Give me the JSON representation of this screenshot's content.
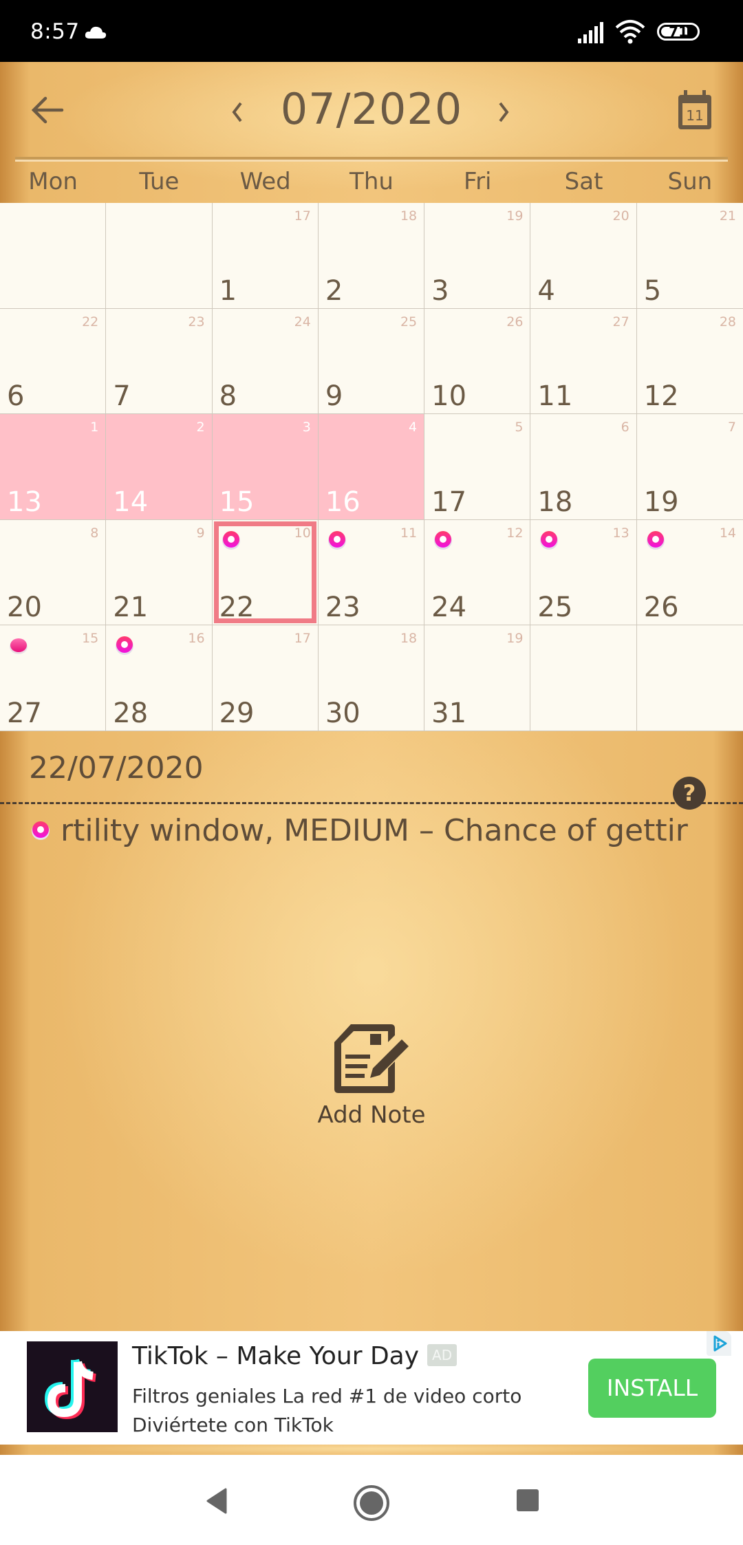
{
  "status_bar": {
    "time": "8:57",
    "battery": "71",
    "icons": [
      "cloud-icon",
      "signal-icon",
      "wifi-icon",
      "battery-icon"
    ]
  },
  "header": {
    "back_icon": "arrow-left-icon",
    "prev_icon": "chevron-left-icon",
    "title": "07/2020",
    "next_icon": "chevron-right-icon",
    "today_icon": "calendar-icon",
    "today_day": "11",
    "weekdays": [
      "Mon",
      "Tue",
      "Wed",
      "Thu",
      "Fri",
      "Sat",
      "Sun"
    ]
  },
  "calendar": {
    "month": "07/2020",
    "selected_day": "22",
    "colors": {
      "period": "#ffc0c8",
      "selected_border": "#f07b86",
      "fertile_marker": "#ff2fa0"
    },
    "cells": [
      {
        "day": "",
        "cycle": "",
        "state": "empty",
        "marker": ""
      },
      {
        "day": "",
        "cycle": "",
        "state": "empty",
        "marker": ""
      },
      {
        "day": "1",
        "cycle": "17",
        "state": "normal",
        "marker": ""
      },
      {
        "day": "2",
        "cycle": "18",
        "state": "normal",
        "marker": ""
      },
      {
        "day": "3",
        "cycle": "19",
        "state": "normal",
        "marker": ""
      },
      {
        "day": "4",
        "cycle": "20",
        "state": "normal",
        "marker": ""
      },
      {
        "day": "5",
        "cycle": "21",
        "state": "normal",
        "marker": ""
      },
      {
        "day": "6",
        "cycle": "22",
        "state": "normal",
        "marker": ""
      },
      {
        "day": "7",
        "cycle": "23",
        "state": "normal",
        "marker": ""
      },
      {
        "day": "8",
        "cycle": "24",
        "state": "normal",
        "marker": ""
      },
      {
        "day": "9",
        "cycle": "25",
        "state": "normal",
        "marker": ""
      },
      {
        "day": "10",
        "cycle": "26",
        "state": "normal",
        "marker": ""
      },
      {
        "day": "11",
        "cycle": "27",
        "state": "normal",
        "marker": ""
      },
      {
        "day": "12",
        "cycle": "28",
        "state": "normal",
        "marker": ""
      },
      {
        "day": "13",
        "cycle": "1",
        "state": "period",
        "marker": ""
      },
      {
        "day": "14",
        "cycle": "2",
        "state": "period",
        "marker": ""
      },
      {
        "day": "15",
        "cycle": "3",
        "state": "period",
        "marker": ""
      },
      {
        "day": "16",
        "cycle": "4",
        "state": "period",
        "marker": ""
      },
      {
        "day": "17",
        "cycle": "5",
        "state": "normal",
        "marker": ""
      },
      {
        "day": "18",
        "cycle": "6",
        "state": "normal",
        "marker": ""
      },
      {
        "day": "19",
        "cycle": "7",
        "state": "normal",
        "marker": ""
      },
      {
        "day": "20",
        "cycle": "8",
        "state": "normal",
        "marker": ""
      },
      {
        "day": "21",
        "cycle": "9",
        "state": "normal",
        "marker": ""
      },
      {
        "day": "22",
        "cycle": "10",
        "state": "selected",
        "marker": "fertile-flower"
      },
      {
        "day": "23",
        "cycle": "11",
        "state": "normal",
        "marker": "fertile-flower"
      },
      {
        "day": "24",
        "cycle": "12",
        "state": "normal",
        "marker": "fertile-flower"
      },
      {
        "day": "25",
        "cycle": "13",
        "state": "normal",
        "marker": "fertile-flower"
      },
      {
        "day": "26",
        "cycle": "14",
        "state": "normal",
        "marker": "fertile-flower"
      },
      {
        "day": "27",
        "cycle": "15",
        "state": "normal",
        "marker": "ovulation-egg"
      },
      {
        "day": "28",
        "cycle": "16",
        "state": "normal",
        "marker": "fertile-flower"
      },
      {
        "day": "29",
        "cycle": "17",
        "state": "normal",
        "marker": ""
      },
      {
        "day": "30",
        "cycle": "18",
        "state": "normal",
        "marker": ""
      },
      {
        "day": "31",
        "cycle": "19",
        "state": "normal",
        "marker": ""
      },
      {
        "day": "",
        "cycle": "",
        "state": "empty",
        "marker": ""
      },
      {
        "day": "",
        "cycle": "",
        "state": "empty",
        "marker": ""
      }
    ]
  },
  "detail": {
    "date": "22/07/2020",
    "help_label": "?",
    "event_text": "rtility window, MEDIUM – Chance of gettir",
    "event_icon": "fertile-flower-icon",
    "add_note_label": "Add Note",
    "add_note_icon": "note-edit-icon"
  },
  "ad": {
    "title": "TikTok – Make Your Day",
    "badge": "AD",
    "line1": "Filtros geniales La red #1 de video corto",
    "line2": "Diviértete con TikTok",
    "install_label": "INSTALL",
    "install_color": "#53cf5f",
    "app_icon": "tiktok-logo-icon",
    "adchoices_icon": "adchoices-icon"
  },
  "nav_bar": {
    "buttons": [
      "back-icon",
      "home-icon",
      "recents-icon"
    ]
  }
}
